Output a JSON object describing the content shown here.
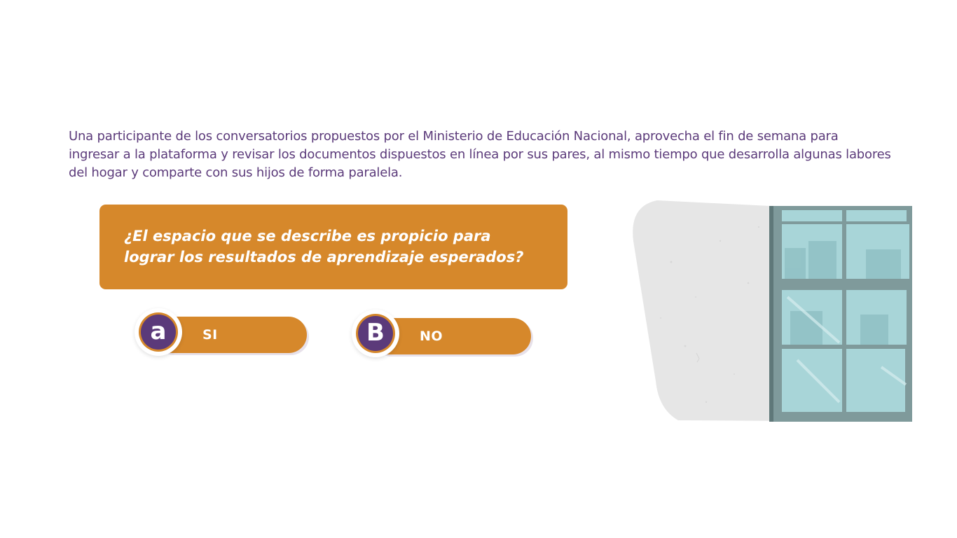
{
  "scenario": {
    "text": "Una participante de los conversatorios propuestos por el Ministerio de Educación Nacional, aprovecha el fin de semana para ingresar a la plataforma y revisar los documentos dispuestos en línea por sus pares, al mismo tiempo que desarrolla algunas labores del hogar y comparte con sus hijos de forma paralela."
  },
  "question": {
    "text": "¿El espacio que se describe es propicio para lograr los resultados de aprendizaje esperados?"
  },
  "options": [
    {
      "badge": "a",
      "label": "SI"
    },
    {
      "badge": "B",
      "label": "NO"
    }
  ],
  "colors": {
    "accent_orange": "#d6882b",
    "brand_purple": "#5b3a7a",
    "text_purple": "#5b3a7a",
    "wall_gray": "#e6e6e6",
    "window_glass": "#a8d5d8",
    "window_frame": "#7f9a9b"
  },
  "illustration": {
    "subject": "window-in-wall-illustration"
  }
}
